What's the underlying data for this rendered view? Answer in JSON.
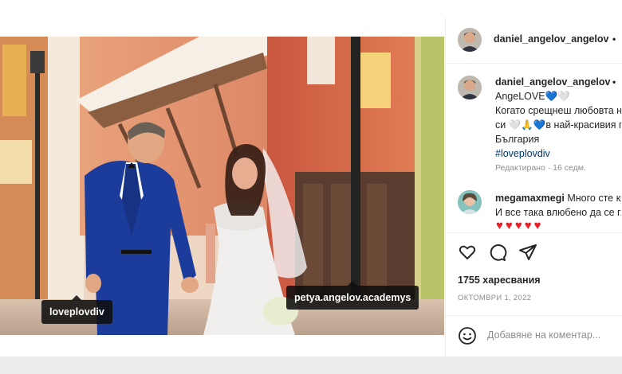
{
  "post": {
    "username": "daniel_angelov_angelov",
    "header_dot": "•",
    "caption": {
      "username": "daniel_angelov_angelov",
      "dot": "•",
      "line1": "AngeLOVE💙🤍",
      "line2": "Когато срещнеш любовта на живота",
      "line3": "си 🤍🙏💙в най-красивия град в",
      "line4": "България",
      "hashtag": "#loveplovdiv"
    },
    "edited": "Редактирано · 16 седм.",
    "comment": {
      "username": "megamaxmegi",
      "text_part1": "Много сте красиви",
      "text_part2": "И все така влюбено да се гледате",
      "hearts": [
        "♥",
        "♥",
        "♥",
        "♥",
        "♥"
      ]
    },
    "likes": "1755 харесвания",
    "date": "ОКТОМВРИ 1, 2022",
    "comment_placeholder": "Добавяне на коментар..."
  },
  "photo_tags": {
    "left": "loveplovdiv",
    "right": "petya.angelov.academys"
  },
  "icons": {
    "like": "heart-outline-icon",
    "comment": "speech-bubble-icon",
    "share": "paper-plane-icon",
    "emoji": "smiley-icon",
    "tag_user": "user-silhouette-icon",
    "more": "more-options-icon"
  },
  "colors": {
    "hashtag": "#00376b",
    "heart_red": "#ed1c24",
    "blue_heart": "#2e7fd6",
    "suit_blue": "#1c3c9c"
  }
}
